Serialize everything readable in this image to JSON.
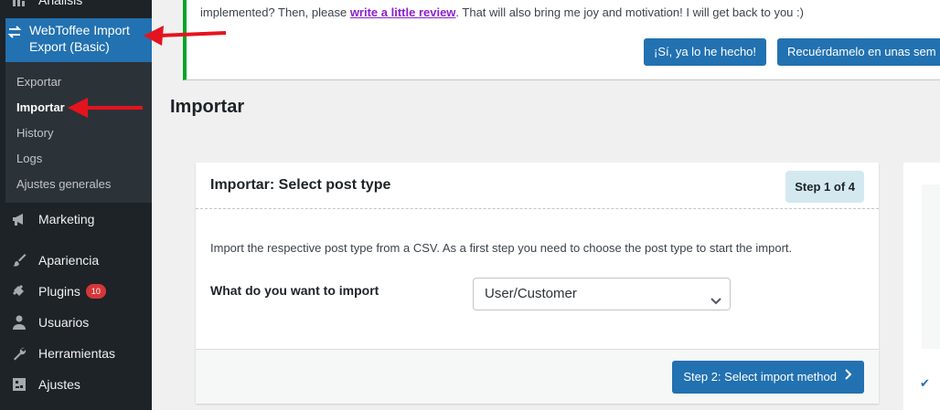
{
  "sidebar": {
    "partial_top_label": "Análisis",
    "active_item": {
      "label": "WebToffee Import Export (Basic)",
      "icon": "import-export-icon"
    },
    "submenu": [
      {
        "label": "Exportar",
        "current": false
      },
      {
        "label": "Importar",
        "current": true
      },
      {
        "label": "History",
        "current": false
      },
      {
        "label": "Logs",
        "current": false
      },
      {
        "label": "Ajustes generales",
        "current": false
      }
    ],
    "items": [
      {
        "label": "Marketing",
        "icon": "megaphone-icon"
      },
      {
        "label": "Apariencia",
        "icon": "paintbrush-icon"
      },
      {
        "label": "Plugins",
        "icon": "plugin-icon",
        "badge": "10"
      },
      {
        "label": "Usuarios",
        "icon": "users-icon"
      },
      {
        "label": "Herramientas",
        "icon": "wrench-icon"
      },
      {
        "label": "Ajustes",
        "icon": "settings-icon"
      }
    ]
  },
  "notice": {
    "text_before": "implemented? Then, please ",
    "link": "write a little review",
    "text_after": ". That will also bring me joy and motivation! I will get back to you :)",
    "btn_done": "¡Sí, ya lo he hecho!",
    "btn_remind": "Recuérdamelo en unas sem"
  },
  "page": {
    "title": "Importar"
  },
  "card": {
    "title": "Importar: Select post type",
    "step": "Step 1 of 4",
    "description": "Import the respective post type from a CSV. As a first step you need to choose the post type to start the import.",
    "question": "What do you want to import",
    "selected": "User/Customer",
    "next_button": "Step 2: Select import method"
  },
  "colors": {
    "accent": "#2271b1",
    "sidebar_bg": "#1d2327",
    "notice_border": "#00a32a",
    "arrow": "#e5131d",
    "badge": "#d63638"
  }
}
